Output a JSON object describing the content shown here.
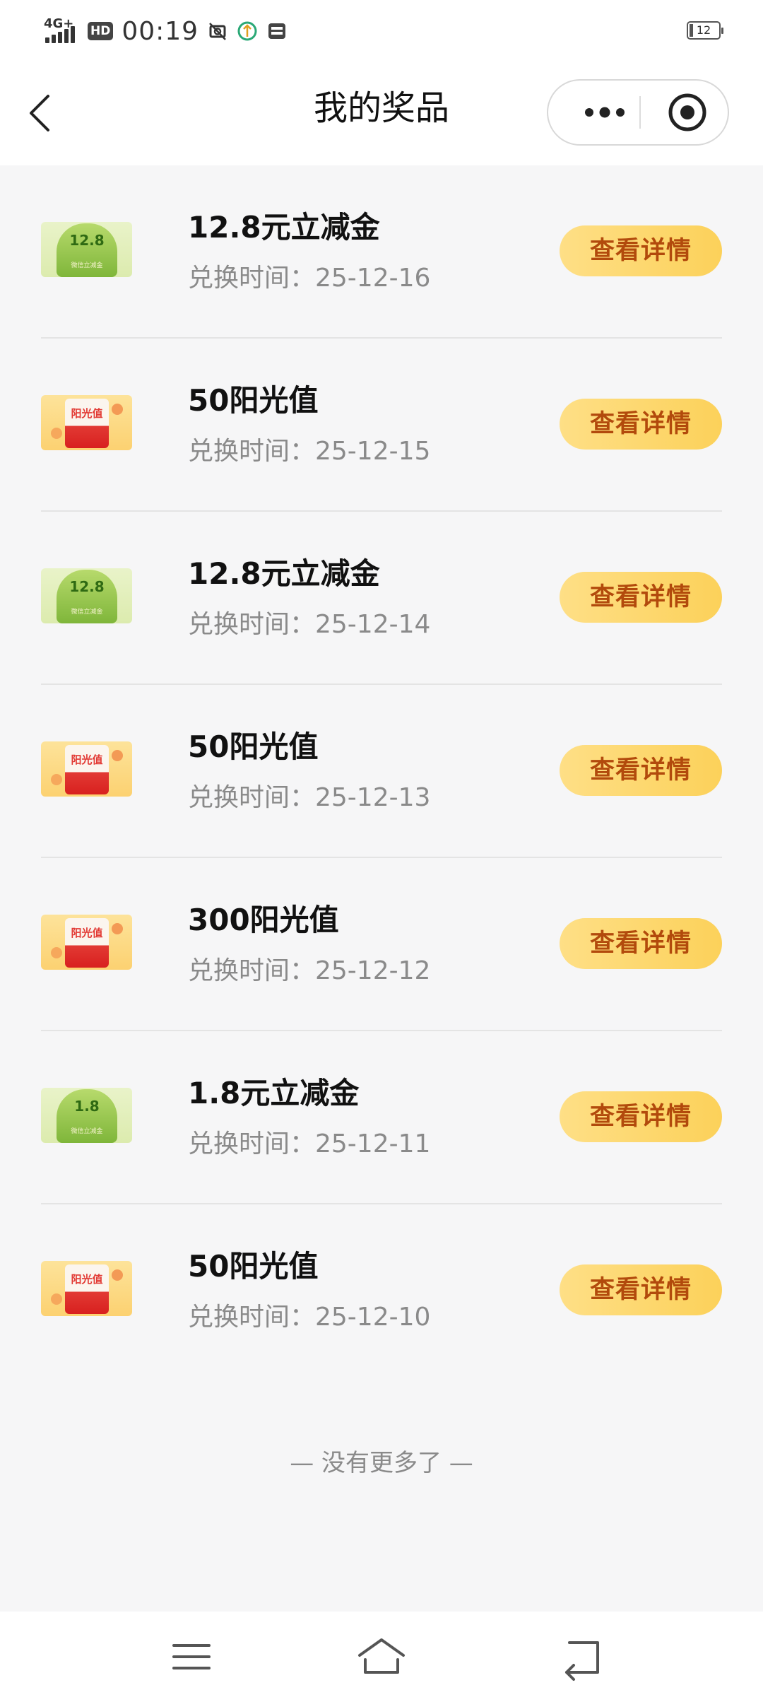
{
  "status_bar": {
    "network": "4G+",
    "hd": "HD",
    "time": "00:19",
    "battery": "12",
    "battery_level": 0.12
  },
  "header": {
    "title": "我的奖品",
    "back_icon": "chevron-left-icon",
    "more_icon": "more-dots-icon",
    "close_icon": "target-circle-icon"
  },
  "prizes": [
    {
      "name": "12.8元立减金",
      "date": "兑换时间：25-12-16",
      "button": "查看详情",
      "thumb": "green",
      "thumb_text": "12.8",
      "thumb_sub": "微信立减金"
    },
    {
      "name": "50阳光值",
      "date": "兑换时间：25-12-15",
      "button": "查看详情",
      "thumb": "orange",
      "thumb_text": "阳光值"
    },
    {
      "name": "12.8元立减金",
      "date": "兑换时间：25-12-14",
      "button": "查看详情",
      "thumb": "green",
      "thumb_text": "12.8",
      "thumb_sub": "微信立减金"
    },
    {
      "name": "50阳光值",
      "date": "兑换时间：25-12-13",
      "button": "查看详情",
      "thumb": "orange",
      "thumb_text": "阳光值"
    },
    {
      "name": "300阳光值",
      "date": "兑换时间：25-12-12",
      "button": "查看详情",
      "thumb": "orange",
      "thumb_text": "阳光值"
    },
    {
      "name": "1.8元立减金",
      "date": "兑换时间：25-12-11",
      "button": "查看详情",
      "thumb": "green",
      "thumb_text": "1.8",
      "thumb_sub": "微信立减金"
    },
    {
      "name": "50阳光值",
      "date": "兑换时间：25-12-10",
      "button": "查看详情",
      "thumb": "orange",
      "thumb_text": "阳光值"
    }
  ],
  "footer": {
    "end_text": "— 没有更多了 —"
  },
  "colors": {
    "accent_button": "#fcd15a",
    "button_text": "#b24a0c",
    "background": "#f6f6f7"
  }
}
